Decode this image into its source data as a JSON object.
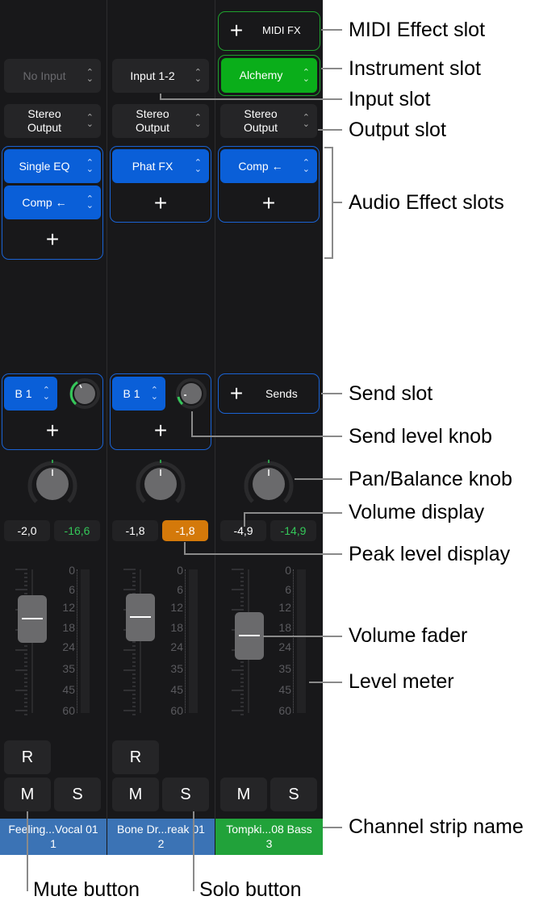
{
  "strips": [
    {
      "input": "No Input",
      "output": "Stereo Output",
      "fx": [
        "Single EQ",
        "Comp ←"
      ],
      "send": "B 1",
      "volume": "-2,0",
      "peak": "-16,6",
      "record": "R",
      "mute": "M",
      "solo": "S",
      "name": "Feeling...Vocal 01",
      "number": "1",
      "color": "#3b73b5"
    },
    {
      "input": "Input 1-2",
      "output": "Stereo Output",
      "fx": [
        "Phat FX"
      ],
      "send": "B 1",
      "volume": "-1,8",
      "peak": "-1,8",
      "record": "R",
      "mute": "M",
      "solo": "S",
      "name": "Bone Dr...reak 01",
      "number": "2",
      "color": "#3b73b5"
    },
    {
      "midi_fx": "MIDI FX",
      "instrument": "Alchemy",
      "output": "Stereo Output",
      "fx": [
        "Comp ←"
      ],
      "send": "Sends",
      "volume": "-4,9",
      "peak": "-14,9",
      "mute": "M",
      "solo": "S",
      "name": "Tompki...08 Bass",
      "number": "3",
      "color": "#21a23a"
    }
  ],
  "scale": [
    "0",
    "6",
    "12",
    "18",
    "24",
    "35",
    "45",
    "60"
  ],
  "colors": {
    "accent_blue": "#0a5fd8",
    "instrument_green": "#0aae1a",
    "peak_orange": "#d4790a",
    "background": "#18181a"
  },
  "callouts": {
    "midi_fx": "MIDI Effect slot",
    "instrument": "Instrument slot",
    "input": "Input slot",
    "output": "Output slot",
    "audio_fx": "Audio Effect slots",
    "send": "Send slot",
    "send_knob": "Send level knob",
    "pan": "Pan/Balance knob",
    "volume_display": "Volume display",
    "peak": "Peak level display",
    "fader": "Volume fader",
    "meter": "Level meter",
    "name": "Channel strip name",
    "mute": "Mute button",
    "solo": "Solo button"
  }
}
